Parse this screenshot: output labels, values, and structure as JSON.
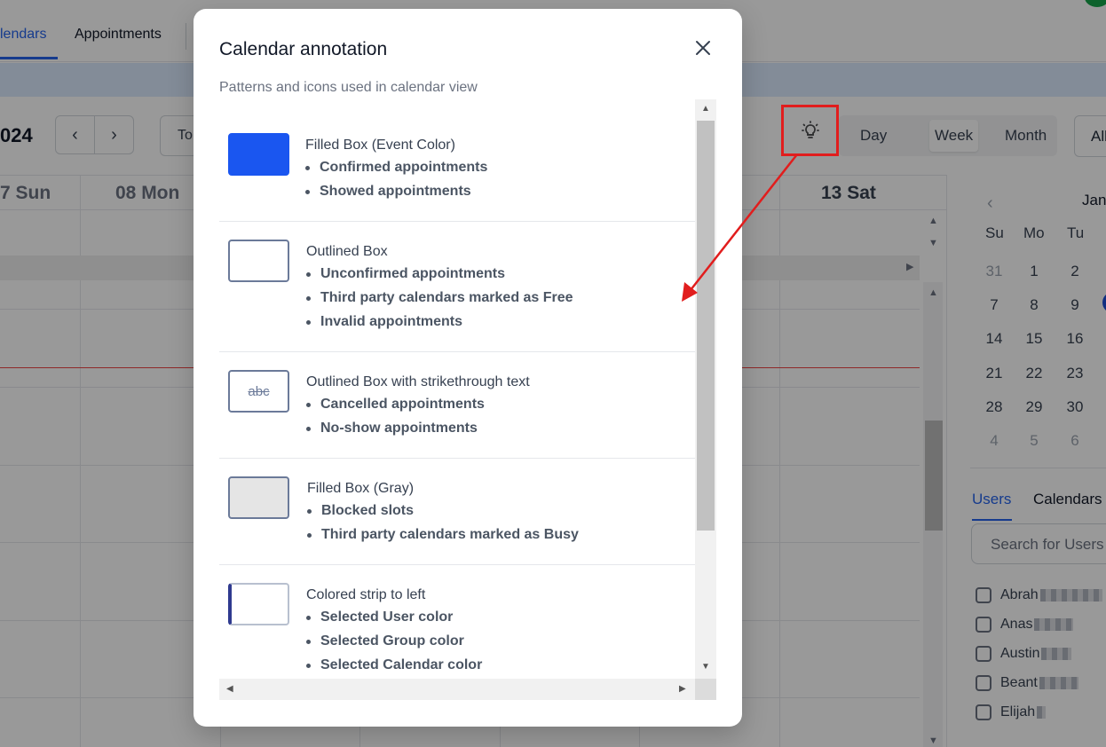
{
  "nav": {
    "tab_calendars": "lendars",
    "tab_appointments": "Appointments"
  },
  "toolbar": {
    "year": "024",
    "prev_icon": "‹",
    "next_icon": "›",
    "today_label": "To",
    "view_day": "Day",
    "view_week": "Week",
    "view_month": "Month",
    "all_label": "All"
  },
  "grid": {
    "day_sun": "7 Sun",
    "day_mon": "08 Mon",
    "day_sat": "13 Sat"
  },
  "mini_calendar": {
    "month": "Jan",
    "weekdays": [
      "Su",
      "Mo",
      "Tu"
    ],
    "rows": [
      [
        "31",
        "1",
        "2"
      ],
      [
        "7",
        "8",
        "9"
      ],
      [
        "14",
        "15",
        "16"
      ],
      [
        "21",
        "22",
        "23"
      ],
      [
        "28",
        "29",
        "30"
      ],
      [
        "4",
        "5",
        "6"
      ]
    ]
  },
  "sidebar": {
    "tab_users": "Users",
    "tab_calendars": "Calendars",
    "search_placeholder": "Search for Users",
    "users": [
      "Abrah",
      "Anas",
      "Austin",
      "Beant",
      "Elijah"
    ]
  },
  "modal": {
    "title": "Calendar annotation",
    "subtitle": "Patterns and icons used in calendar view",
    "items": [
      {
        "title": "Filled Box (Event Color)",
        "bullets": [
          "Confirmed appointments",
          "Showed appointments"
        ],
        "swatch": "filled-blue"
      },
      {
        "title": "Outlined Box",
        "bullets": [
          "Unconfirmed appointments",
          "Third party calendars marked as Free",
          "Invalid appointments"
        ],
        "swatch": "outlined"
      },
      {
        "title": "Outlined Box with strikethrough text",
        "bullets": [
          "Cancelled appointments",
          "No-show appointments"
        ],
        "swatch": "strikethrough",
        "swatch_text": "abc"
      },
      {
        "title": "Filled Box (Gray)",
        "bullets": [
          "Blocked slots",
          "Third party calendars marked as Busy"
        ],
        "swatch": "filled-gray"
      },
      {
        "title": "Colored strip to left",
        "bullets": [
          "Selected User color",
          "Selected Group color",
          "Selected Calendar color"
        ],
        "swatch": "strip-left"
      }
    ]
  },
  "colors": {
    "accent": "#2563eb",
    "event_blue": "#1a56f0",
    "swatch_border": "#6b7a99",
    "gray_fill": "#e5e5e5",
    "annotation_red": "#e11d1d"
  }
}
